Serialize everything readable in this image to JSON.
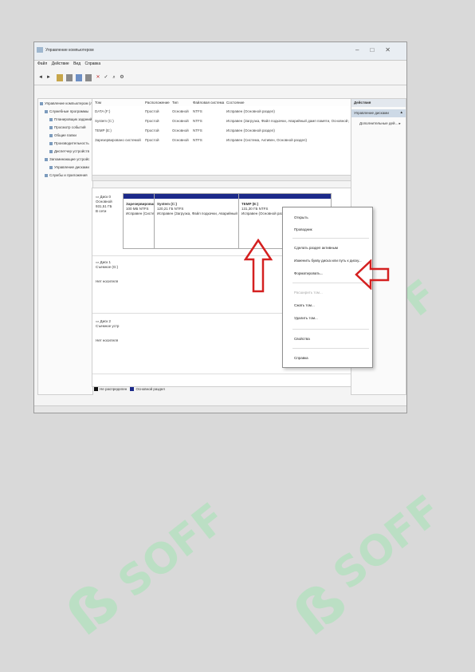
{
  "watermark": {
    "text": "SOFF",
    "glyph": "ẞ",
    "color": "#8ee6a9"
  },
  "window": {
    "title": "Управление компьютером"
  },
  "menu": [
    "Файл",
    "Действие",
    "Вид",
    "Справка"
  ],
  "nav_items": [
    "Управление компьютером (л",
    "Служебные программы",
    "Планировщик заданий",
    "Просмотр событий",
    "Общие папки",
    "Производительность",
    "Диспетчер устройств",
    "Запоминающие устройс",
    "Управление дисками",
    "Службы и приложения"
  ],
  "volume_table": {
    "headers": [
      "Том",
      "Расположение",
      "Тип",
      "Файловая система",
      "Состояние"
    ],
    "rows": [
      [
        "DATA (F:)",
        "Простой",
        "Основной",
        "NTFS",
        "Исправен (Основной раздел)"
      ],
      [
        "System (C:)",
        "Простой",
        "Основной",
        "NTFS",
        "Исправен (Загрузка, Файл подкачки, Аварийный дамп памяти, Основной р"
      ],
      [
        "TEMP (E:)",
        "Простой",
        "Основной",
        "NTFS",
        "Исправен (Основной раздел)"
      ],
      [
        "Зарезервировано системой",
        "Простой",
        "Основной",
        "NTFS",
        "Исправен (Система, Активен, Основной раздел)"
      ]
    ]
  },
  "disks": [
    {
      "name": "Диск 0",
      "lines": [
        "Основной",
        "931,51 ГБ",
        "В сети"
      ],
      "partitions": [
        {
          "name": "Зарезервировано",
          "size": "100 МБ NTFS",
          "status": "Исправен (Систе"
        },
        {
          "name": "System (C:)",
          "size": "120,21 ГБ NTFS",
          "status": "Исправен (Загрузка, Файл подкачки, Аварийный"
        },
        {
          "name": "TEMP (E:)",
          "size": "131,30 ГБ NTFS",
          "status": "Исправен (Основной разд"
        }
      ]
    },
    {
      "name": "Диск 1",
      "lines": [
        "Съемное (G:)",
        "",
        "Нет носителя"
      ]
    },
    {
      "name": "Диск 2",
      "lines": [
        "Съемное устр",
        "",
        "Нет носителя"
      ]
    }
  ],
  "legend": [
    "Не распределен",
    "Основной раздел"
  ],
  "actions": {
    "title": "Действия",
    "selected": "Управление дисками",
    "more": "Дополнительные дей..."
  },
  "context_menu": {
    "items": [
      {
        "label": "Открыть",
        "disabled": false
      },
      {
        "label": "Проводник",
        "disabled": false
      },
      {
        "label": "Сделать раздел активным",
        "disabled": false
      },
      {
        "label": "Изменить букву диска или путь к диску...",
        "disabled": false
      },
      {
        "label": "Форматировать...",
        "disabled": false
      },
      {
        "label": "Расширить том...",
        "disabled": true
      },
      {
        "label": "Сжать том...",
        "disabled": false
      },
      {
        "label": "Удалить том...",
        "disabled": false
      },
      {
        "label": "Свойства",
        "disabled": false
      },
      {
        "label": "Справка",
        "disabled": false
      }
    ]
  },
  "colors": {
    "arrow": "#d42020",
    "partition_bar": "#1c2a8a"
  }
}
